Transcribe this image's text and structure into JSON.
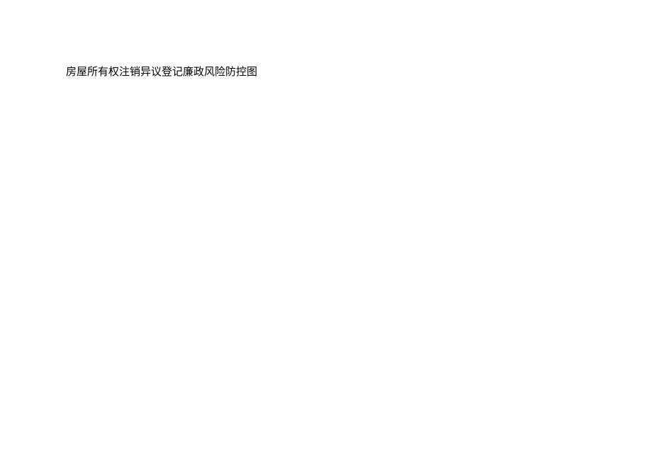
{
  "document": {
    "title": "房屋所有权注销异议登记廉政风险防控图"
  }
}
